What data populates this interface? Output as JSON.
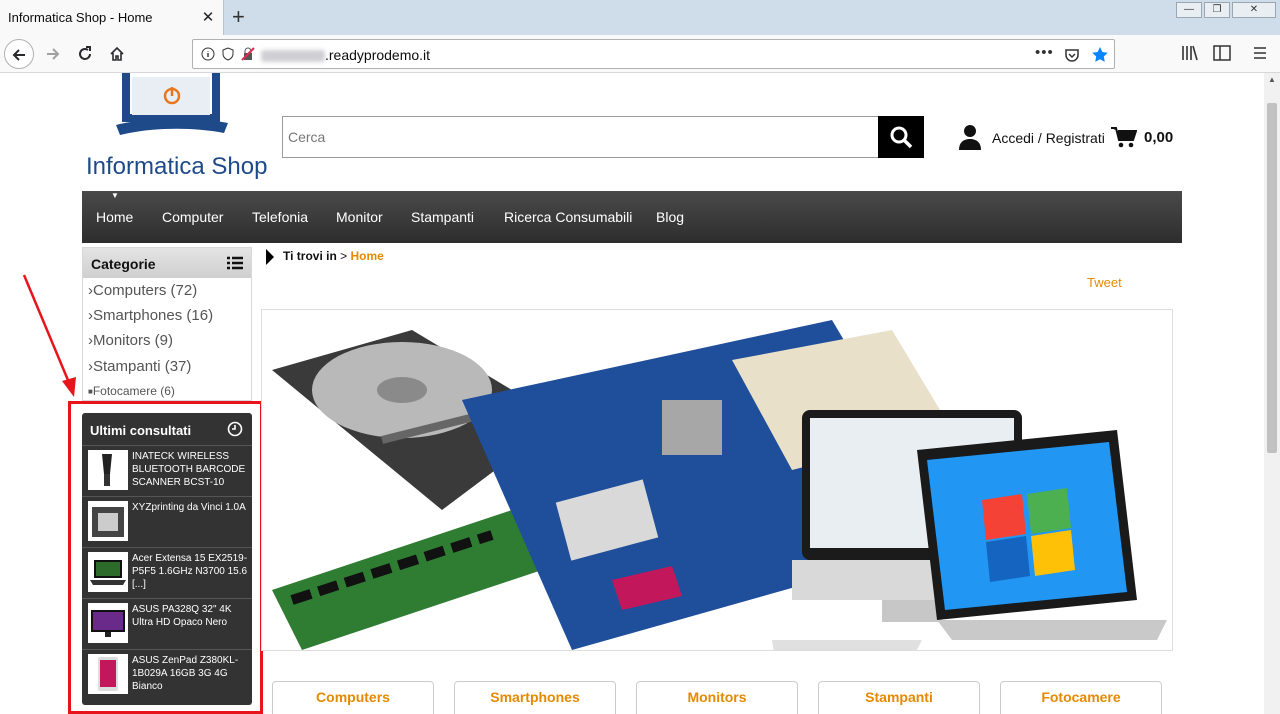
{
  "browser": {
    "tab_title": "Informatica Shop - Home",
    "tab_close": "✕",
    "new_tab": "+",
    "url": ".readyprodemo.it",
    "window_controls": [
      "—",
      "❐",
      "✕"
    ]
  },
  "header": {
    "logo_text": "Informatica Shop",
    "search_placeholder": "Cerca",
    "login_label": "Accedi / Registrati",
    "cart_total": "0,00"
  },
  "menu": [
    "Home",
    "Computer",
    "Telefonia",
    "Monitor",
    "Stampanti",
    "Ricerca Consumabili",
    "Blog"
  ],
  "categories": {
    "title": "Categorie",
    "items": [
      {
        "label": "Computers (72)"
      },
      {
        "label": "Smartphones (16)"
      },
      {
        "label": "Monitors (9)"
      },
      {
        "label": "Stampanti (37)"
      },
      {
        "label": "Fotocamere (6)"
      }
    ]
  },
  "recent": {
    "title": "Ultimi consultati",
    "items": [
      {
        "name": "INATECK WIRELESS BLUETOOTH BARCODE SCANNER BCST-10"
      },
      {
        "name": "XYZprinting da Vinci 1.0A"
      },
      {
        "name": "Acer Extensa 15 EX2519-P5F5 1.6GHz N3700 15.6 [...]"
      },
      {
        "name": "ASUS PA328Q 32\" 4K Ultra HD Opaco Nero"
      },
      {
        "name": "ASUS ZenPad Z380KL-1B029A 16GB 3G 4G Bianco"
      }
    ]
  },
  "breadcrumb": {
    "prefix": "Ti trovi in",
    "separator": ">",
    "current": "Home"
  },
  "tweet": "Tweet",
  "category_buttons": [
    "Computers",
    "Smartphones",
    "Monitors",
    "Stampanti",
    "Fotocamere"
  ],
  "colors": {
    "accent": "#e58a00",
    "nav_bg": "#3a3a3a",
    "highlight": "#e8141b"
  }
}
